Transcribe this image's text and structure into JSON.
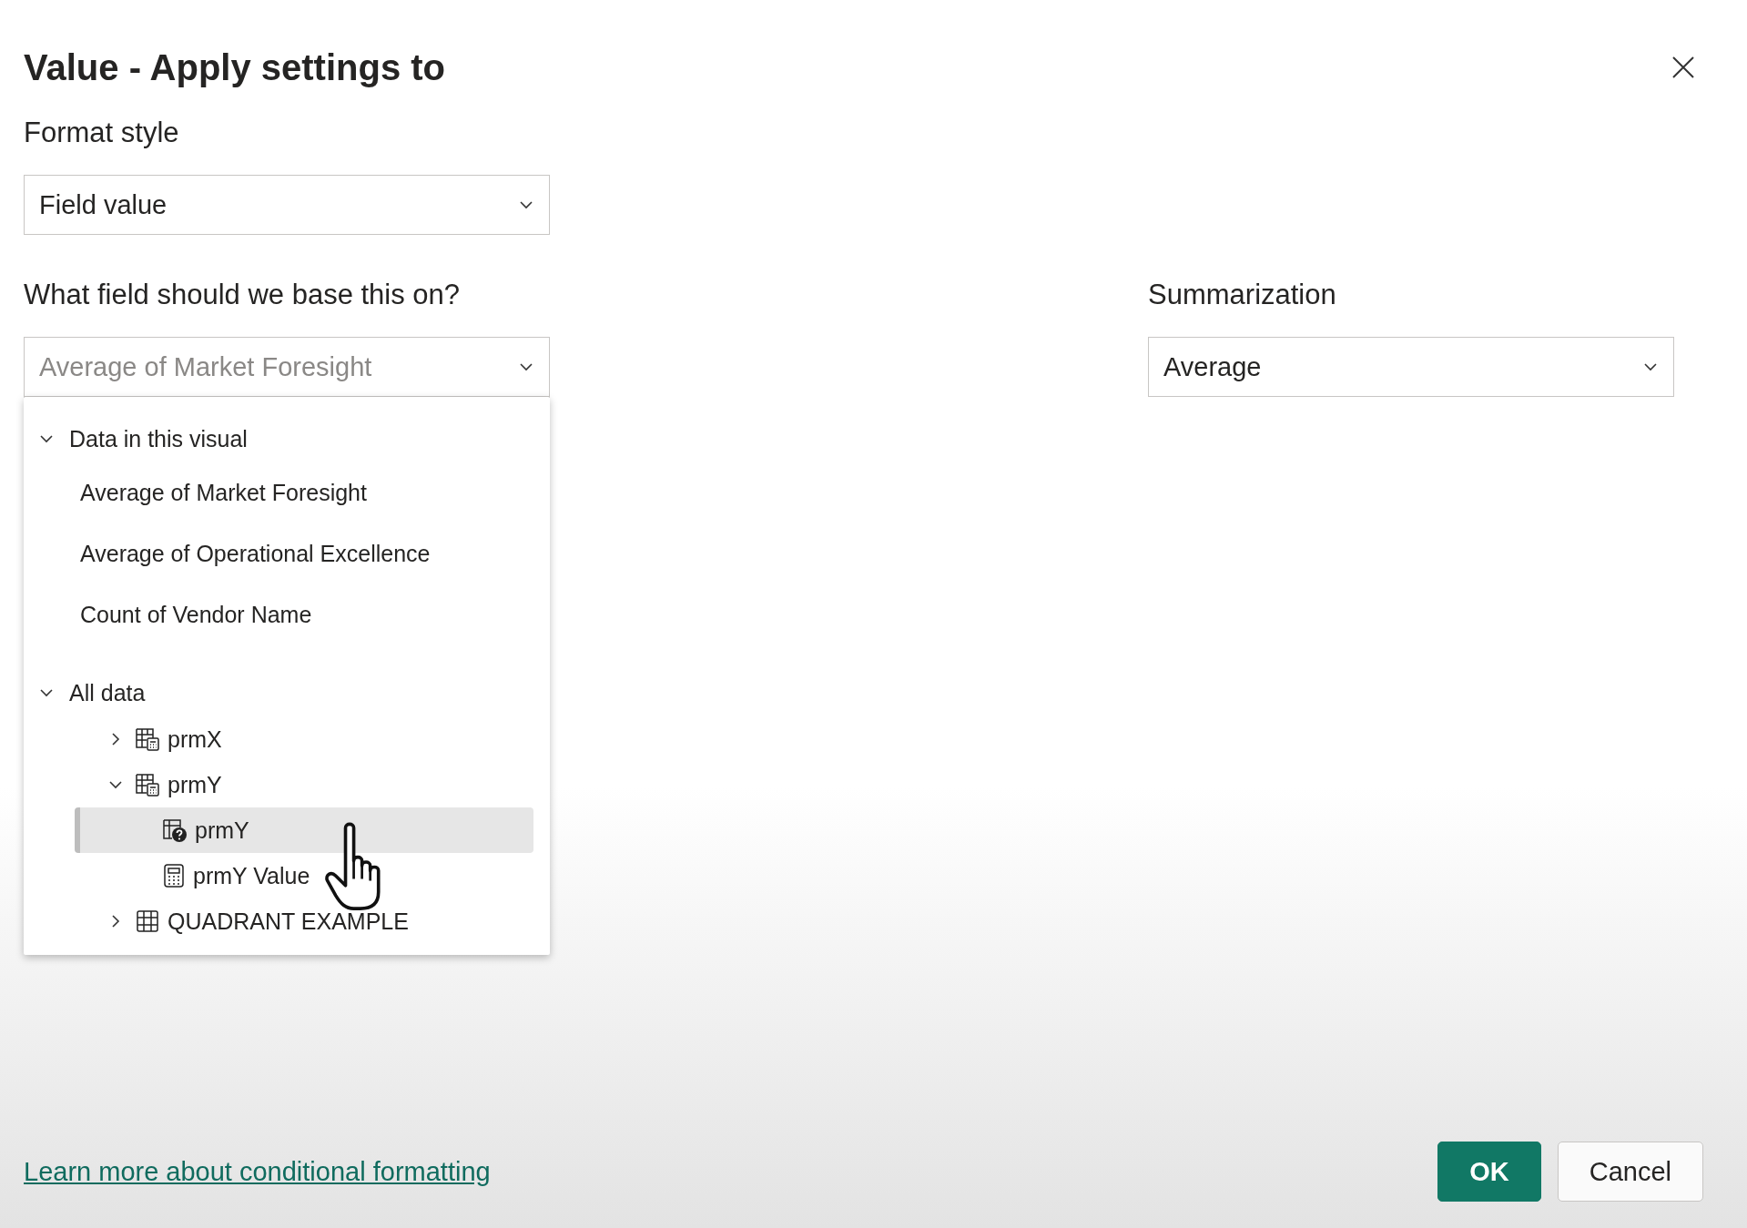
{
  "dialog": {
    "title": "Value - Apply settings to"
  },
  "format_style": {
    "label": "Format style",
    "value": "Field value"
  },
  "base_field": {
    "label": "What field should we base this on?",
    "value": "Average of Market Foresight",
    "expanded": true,
    "menu": [
      {
        "label": "Data in this visual",
        "expanded": true,
        "children": [
          {
            "label": "Average of Market Foresight",
            "selected": false
          },
          {
            "label": "Average of Operational Excellence",
            "selected": false
          },
          {
            "label": "Count of Vendor Name",
            "selected": false
          }
        ]
      },
      {
        "label": "All data",
        "expanded": true,
        "children": [
          {
            "label": "prmX",
            "kind": "table-calc",
            "expanded": false,
            "selected": false
          },
          {
            "label": "prmY",
            "kind": "table-calc",
            "expanded": true,
            "selected": false,
            "children": [
              {
                "label": "prmY",
                "kind": "parameter",
                "selected": true
              },
              {
                "label": "prmY Value",
                "kind": "calculator",
                "selected": false
              }
            ]
          },
          {
            "label": "QUADRANT EXAMPLE",
            "kind": "table",
            "expanded": false,
            "selected": false
          }
        ]
      }
    ]
  },
  "summarization": {
    "label": "Summarization",
    "value": "Average"
  },
  "link": "Learn more about conditional formatting",
  "buttons": [
    {
      "label": "OK",
      "kind": "primary"
    },
    {
      "label": "Cancel",
      "kind": "secondary"
    }
  ]
}
